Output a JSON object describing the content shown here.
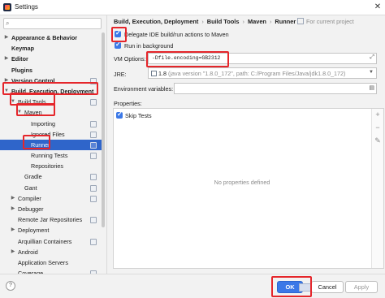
{
  "window": {
    "title": "Settings"
  },
  "sidebar": {
    "items": [
      {
        "label": "Appearance & Behavior",
        "bold": true,
        "arrow": "right",
        "indent": 0
      },
      {
        "label": "Keymap",
        "bold": true,
        "arrow": "",
        "indent": 0
      },
      {
        "label": "Editor",
        "bold": true,
        "arrow": "right",
        "indent": 0
      },
      {
        "label": "Plugins",
        "bold": true,
        "arrow": "",
        "indent": 0
      },
      {
        "label": "Version Control",
        "bold": true,
        "arrow": "right",
        "indent": 0,
        "project": true
      },
      {
        "label": "Build, Execution, Deployment",
        "bold": true,
        "arrow": "down",
        "indent": 0
      },
      {
        "label": "Build Tools",
        "bold": false,
        "arrow": "down",
        "indent": 1,
        "project": true
      },
      {
        "label": "Maven",
        "bold": false,
        "arrow": "down",
        "indent": 2
      },
      {
        "label": "Importing",
        "bold": false,
        "arrow": "",
        "indent": 3,
        "project": true
      },
      {
        "label": "Ignored Files",
        "bold": false,
        "arrow": "",
        "indent": 3,
        "project": true
      },
      {
        "label": "Runner",
        "bold": false,
        "arrow": "",
        "indent": 3,
        "project": true,
        "selected": true
      },
      {
        "label": "Running Tests",
        "bold": false,
        "arrow": "",
        "indent": 3,
        "project": true
      },
      {
        "label": "Repositories",
        "bold": false,
        "arrow": "",
        "indent": 3
      },
      {
        "label": "Gradle",
        "bold": false,
        "arrow": "",
        "indent": 2,
        "project": true
      },
      {
        "label": "Gant",
        "bold": false,
        "arrow": "",
        "indent": 2,
        "project": true
      },
      {
        "label": "Compiler",
        "bold": false,
        "arrow": "right",
        "indent": 1,
        "project": true
      },
      {
        "label": "Debugger",
        "bold": false,
        "arrow": "right",
        "indent": 1
      },
      {
        "label": "Remote Jar Repositories",
        "bold": false,
        "arrow": "",
        "indent": 1,
        "project": true
      },
      {
        "label": "Deployment",
        "bold": false,
        "arrow": "right",
        "indent": 1
      },
      {
        "label": "Arquillian Containers",
        "bold": false,
        "arrow": "",
        "indent": 1,
        "project": true
      },
      {
        "label": "Android",
        "bold": false,
        "arrow": "right",
        "indent": 1
      },
      {
        "label": "Application Servers",
        "bold": false,
        "arrow": "",
        "indent": 1
      },
      {
        "label": "Coverage",
        "bold": false,
        "arrow": "",
        "indent": 1,
        "project": true
      }
    ]
  },
  "breadcrumb": {
    "items": [
      "Build, Execution, Deployment",
      "Build Tools",
      "Maven",
      "Runner"
    ],
    "separator": "›",
    "for_project": "For current project"
  },
  "runner": {
    "delegate_label": "Delegate IDE build/run actions to Maven",
    "delegate_checked": true,
    "background_label": "Run in background",
    "background_checked": true,
    "vm_options_label": "VM Options:",
    "vm_options_value": "-Dfile.encoding=GB2312",
    "jre_label": "JRE:",
    "jre_value": "1.8",
    "jre_detail": "(java version \"1.8.0_172\", path: C:/Program Files/Java/jdk1.8.0_172)",
    "env_label": "Environment variables:",
    "env_value": "",
    "properties_label": "Properties:",
    "skip_tests_label": "Skip Tests",
    "skip_tests_checked": true,
    "no_properties": "No properties defined"
  },
  "footer": {
    "help": "?",
    "ok": "OK",
    "cancel": "Cancel",
    "apply": "Apply"
  },
  "colors": {
    "accent": "#3b78e7",
    "selection": "#2f65ca",
    "highlight": "#e5262b"
  }
}
